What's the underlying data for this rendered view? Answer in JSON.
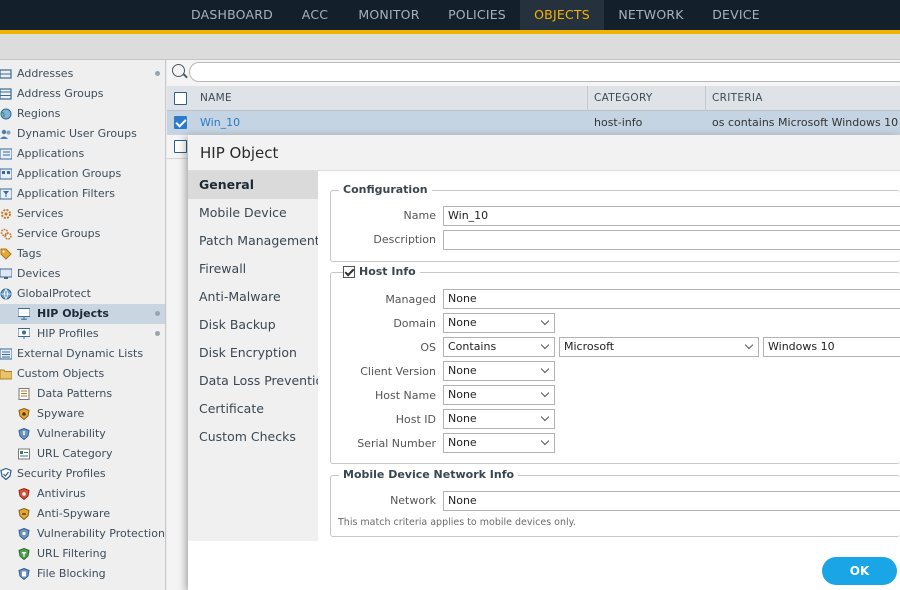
{
  "nav": {
    "tabs": [
      "DASHBOARD",
      "ACC",
      "MONITOR",
      "POLICIES",
      "OBJECTS",
      "NETWORK",
      "DEVICE"
    ],
    "active": "OBJECTS",
    "accent_color": "#f0b400"
  },
  "tree": {
    "items": [
      {
        "label": "Addresses",
        "icon": "address-icon"
      },
      {
        "label": "Address Groups",
        "icon": "address-group-icon"
      },
      {
        "label": "Regions",
        "icon": "globe-icon"
      },
      {
        "label": "Dynamic User Groups",
        "icon": "user-group-icon"
      },
      {
        "label": "Applications",
        "icon": "applications-icon"
      },
      {
        "label": "Application Groups",
        "icon": "application-group-icon"
      },
      {
        "label": "Application Filters",
        "icon": "filter-icon"
      },
      {
        "label": "Services",
        "icon": "gear-icon"
      },
      {
        "label": "Service Groups",
        "icon": "service-group-icon"
      },
      {
        "label": "Tags",
        "icon": "tag-icon"
      },
      {
        "label": "Devices",
        "icon": "device-icon"
      },
      {
        "label": "GlobalProtect",
        "icon": "globalprotect-icon"
      },
      {
        "label": "HIP Objects",
        "icon": "hip-object-icon"
      },
      {
        "label": "HIP Profiles",
        "icon": "hip-profile-icon"
      },
      {
        "label": "External Dynamic Lists",
        "icon": "list-icon"
      },
      {
        "label": "Custom Objects",
        "icon": "folder-icon"
      },
      {
        "label": "Data Patterns",
        "icon": "data-pattern-icon"
      },
      {
        "label": "Spyware",
        "icon": "spyware-icon"
      },
      {
        "label": "Vulnerability",
        "icon": "shield-icon"
      },
      {
        "label": "URL Category",
        "icon": "url-icon"
      },
      {
        "label": "Security Profiles",
        "icon": "security-profile-icon"
      },
      {
        "label": "Antivirus",
        "icon": "antivirus-icon"
      },
      {
        "label": "Anti-Spyware",
        "icon": "anti-spyware-icon"
      },
      {
        "label": "Vulnerability Protection",
        "icon": "vulnerability-protection-icon"
      },
      {
        "label": "URL Filtering",
        "icon": "url-filtering-icon"
      },
      {
        "label": "File Blocking",
        "icon": "file-blocking-icon"
      }
    ],
    "selected": "HIP Objects"
  },
  "table": {
    "columns": [
      "NAME",
      "CATEGORY",
      "CRITERIA"
    ],
    "rows": [
      {
        "name": "Win_10",
        "category": "host-info",
        "criteria": "os contains Microsoft Windows 10",
        "checked": true
      }
    ]
  },
  "dialog": {
    "title": "HIP Object",
    "tabs": [
      "General",
      "Mobile Device",
      "Patch Management",
      "Firewall",
      "Anti-Malware",
      "Disk Backup",
      "Disk Encryption",
      "Data Loss Prevention",
      "Certificate",
      "Custom Checks"
    ],
    "active_tab": "General",
    "configuration": {
      "legend": "Configuration",
      "name_label": "Name",
      "name_value": "Win_10",
      "description_label": "Description",
      "description_value": ""
    },
    "host_info": {
      "legend": "Host Info",
      "checked": true,
      "managed_label": "Managed",
      "managed_value": "None",
      "domain_label": "Domain",
      "domain_value": "None",
      "os_label": "OS",
      "os_operator": "Contains",
      "os_vendor": "Microsoft",
      "os_value": "Windows 10",
      "client_version_label": "Client Version",
      "client_version_value": "None",
      "host_name_label": "Host Name",
      "host_name_value": "None",
      "host_id_label": "Host ID",
      "host_id_value": "None",
      "serial_number_label": "Serial Number",
      "serial_number_value": "None"
    },
    "mobile_network": {
      "legend": "Mobile Device Network Info",
      "network_label": "Network",
      "network_value": "None",
      "note": "This match criteria applies to mobile devices only."
    },
    "ok_label": "OK"
  }
}
